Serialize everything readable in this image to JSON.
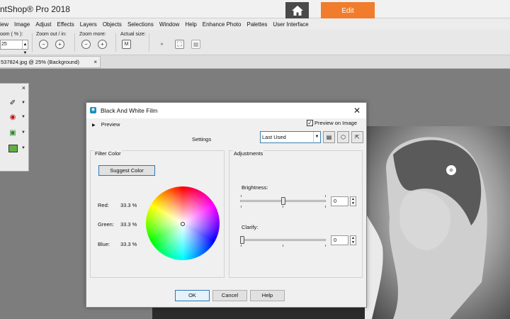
{
  "app": {
    "title": "ntShop® Pro 2018",
    "edit_tab": "Edit"
  },
  "menu": [
    "iew",
    "Image",
    "Adjust",
    "Effects",
    "Layers",
    "Objects",
    "Selections",
    "Window",
    "Help",
    "Enhance Photo",
    "Palettes",
    "User Interface"
  ],
  "toolbar": {
    "zoom_label": "oom ( % ):",
    "zoom_value": "25",
    "zoom_inout_label": "Zoom out / in:",
    "zoom_more_label": "Zoom more:",
    "actual_size_label": "Actual size:",
    "actual_size_icon_text": "M"
  },
  "document_tab": {
    "label": "537824.jpg @  25% (Background)",
    "close": "×"
  },
  "palette": {
    "close": "×"
  },
  "dialog": {
    "title": "Black And White Film",
    "close": "✕",
    "preview_label": "Preview",
    "preview_on_image_label": "Preview on Image",
    "preview_on_image_checked": true,
    "settings_label": "Settings",
    "preset_value": "Last Used",
    "filter_color": {
      "title": "Filter Color",
      "suggest_button": "Suggest Color",
      "red_label": "Red:",
      "red_value": "33.3 %",
      "green_label": "Green:",
      "green_value": "33.3 %",
      "blue_label": "Blue:",
      "blue_value": "33.3 %"
    },
    "adjustments": {
      "title": "Adjustments",
      "brightness_label": "Brightness:",
      "brightness_value": "0",
      "brightness_level": 0.5,
      "clarify_label": "Clarify:",
      "clarify_value": "0",
      "clarify_level": 0.0
    },
    "buttons": {
      "ok": "OK",
      "cancel": "Cancel",
      "help": "Help"
    }
  },
  "colors": {
    "accent": "#f07c2c",
    "home_button": "#4a4a4a",
    "dialog_focus": "#2e77b8"
  }
}
